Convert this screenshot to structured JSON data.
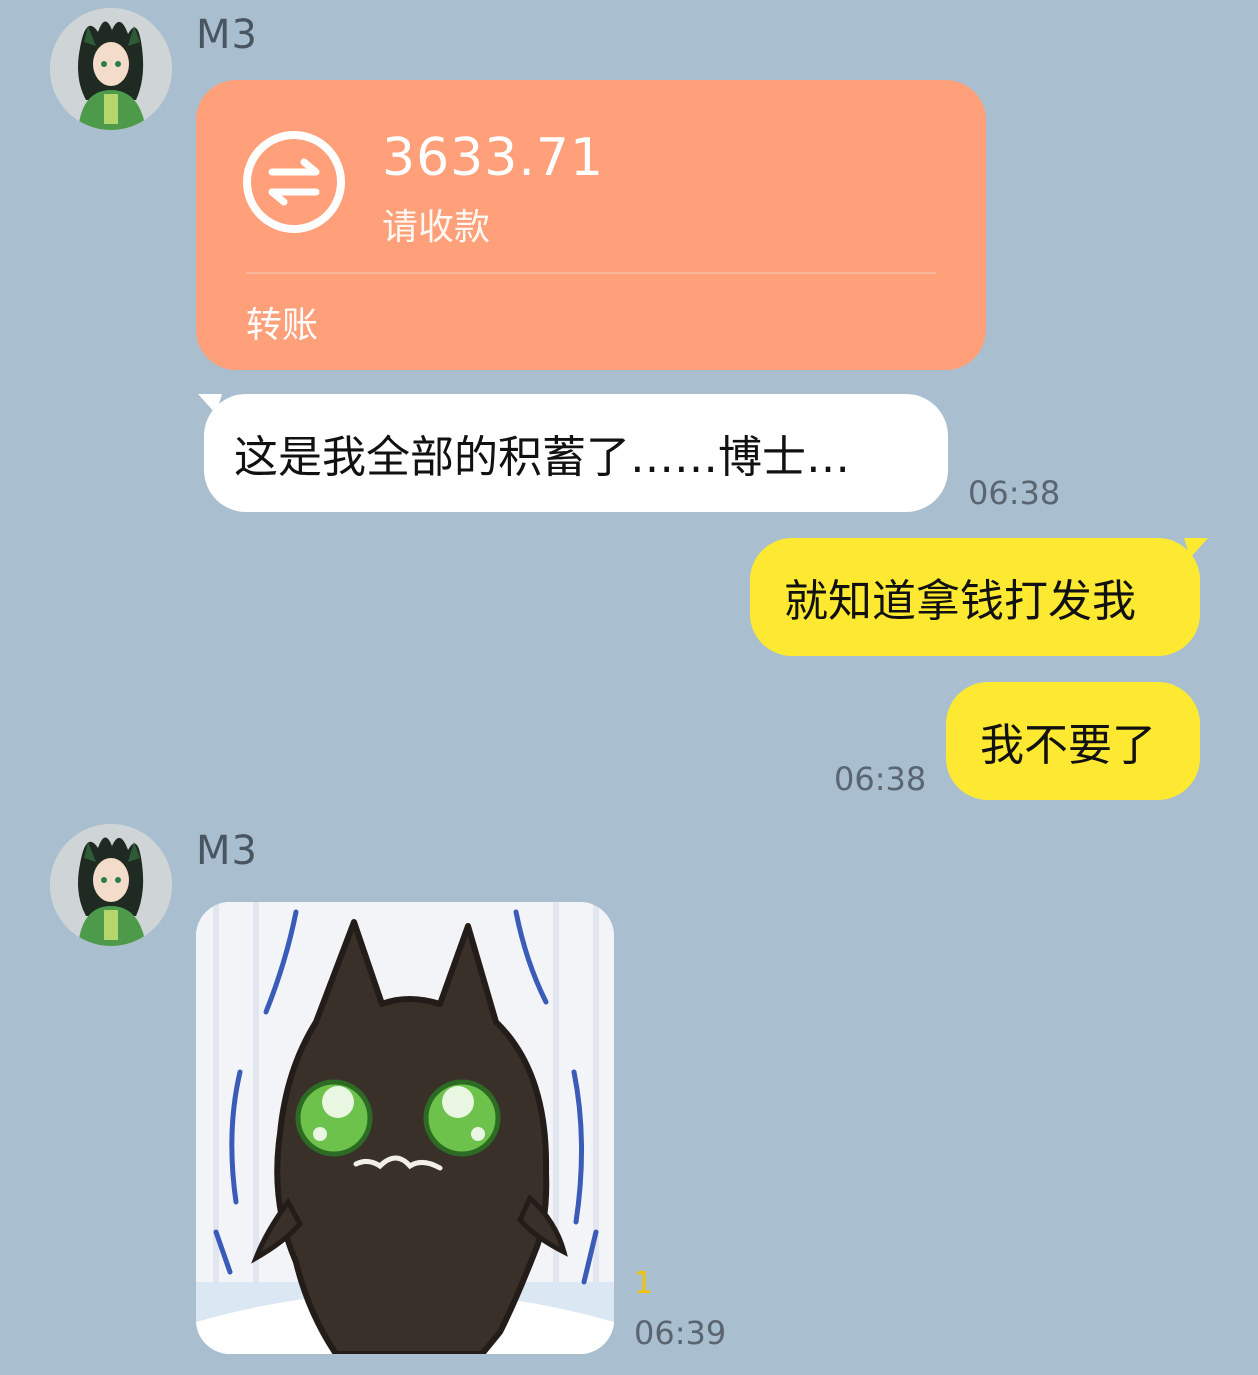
{
  "messages": {
    "m1": {
      "sender": "M3",
      "transfer": {
        "amount": "3633.71",
        "status": "请收款",
        "label": "转账",
        "icon": "transfer-arrows-icon"
      },
      "text": "这是我全部的积蓄了……博士…",
      "time": "06:38"
    },
    "m2": {
      "line1": "就知道拿钱打发我",
      "line2": "我不要了",
      "time": "06:38"
    },
    "m3": {
      "sender": "M3",
      "sticker": "crying-black-cat-sticker",
      "read_count": "1",
      "time": "06:39"
    }
  },
  "colors": {
    "background": "#a9bfcf",
    "transfer_card": "#ffa07a",
    "incoming_bubble": "#ffffff",
    "outgoing_bubble": "#fde931"
  }
}
